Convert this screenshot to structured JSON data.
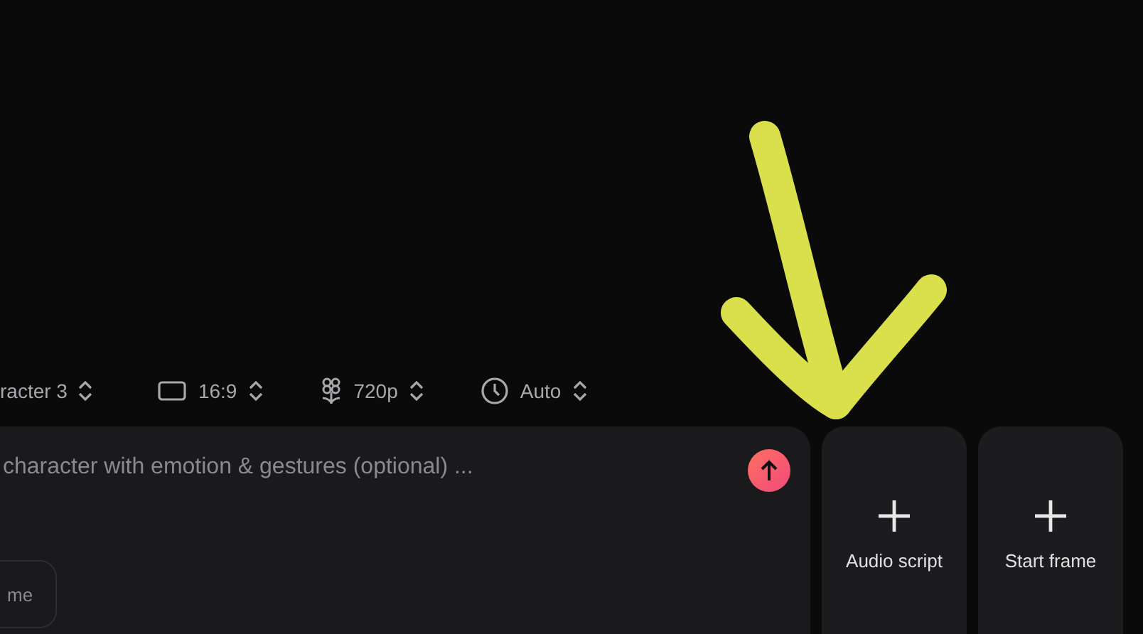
{
  "options": [
    {
      "kind": "text",
      "value": "racter 3"
    },
    {
      "kind": "aspect",
      "value": "16:9"
    },
    {
      "kind": "quality",
      "value": "720p"
    },
    {
      "kind": "duration",
      "value": "Auto"
    }
  ],
  "prompt": {
    "placeholder": "character with emotion & gestures (optional) ...",
    "chip": "me"
  },
  "cards": [
    {
      "label": "Audio script"
    },
    {
      "label": "Start frame"
    }
  ]
}
